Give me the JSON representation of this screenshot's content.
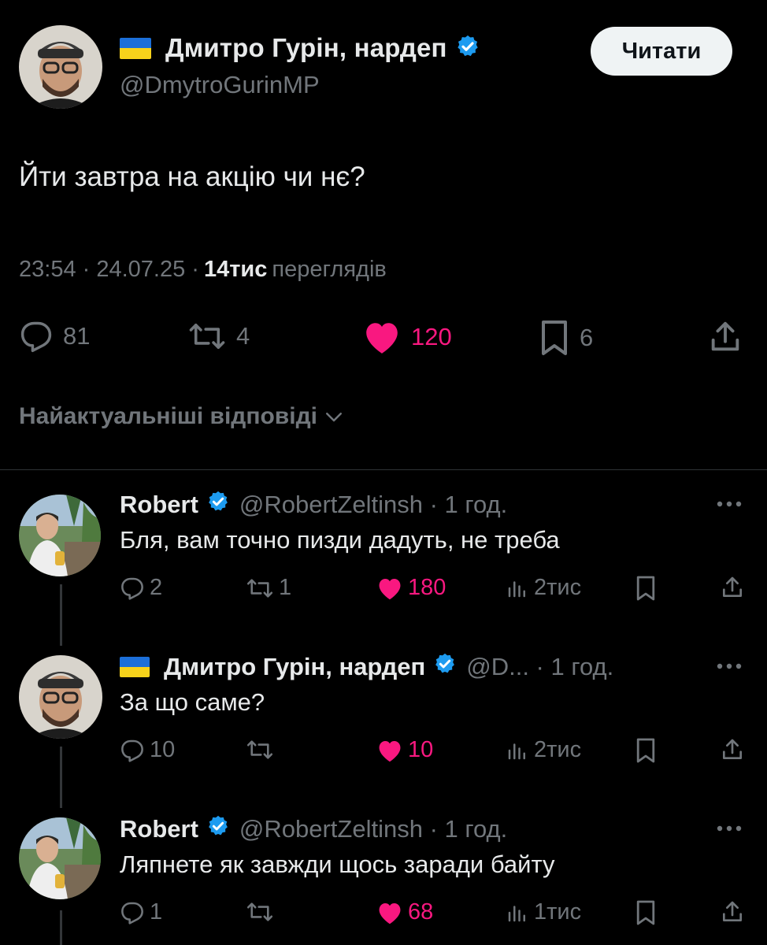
{
  "main_tweet": {
    "author_name": "Дмитро Гурін, нардеп",
    "author_handle": "@DmytroGurinMP",
    "follow_label": "Читати",
    "text": "Йти завтра на акцію чи нє?",
    "time": "23:54 · 24.07.25 ·",
    "views_count": "14тис",
    "views_label": "переглядів",
    "stats": {
      "replies": "81",
      "reposts": "4",
      "likes": "120",
      "bookmarks": "6"
    },
    "accent_like": "#f91880",
    "verified_color": "#1d9bf0"
  },
  "replies_sort_label": "Найактуальніші відповіді",
  "replies": [
    {
      "name": "Robert",
      "handle_time": "@RobertZeltinsh · 1 год.",
      "text": "Бля, вам точно пизди дадуть, не треба",
      "replies": "2",
      "reposts": "1",
      "likes": "180",
      "views": "2тис"
    },
    {
      "name": "Дмитро Гурін, нардеп",
      "handle_time": "@D... · 1 год.",
      "text": "За що саме?",
      "replies": "10",
      "reposts": "",
      "likes": "10",
      "views": "2тис"
    },
    {
      "name": "Robert",
      "handle_time": "@RobertZeltinsh · 1 год.",
      "text": "Ляпнете як завжди щось заради байту",
      "replies": "1",
      "reposts": "",
      "likes": "68",
      "views": "1тис"
    }
  ]
}
